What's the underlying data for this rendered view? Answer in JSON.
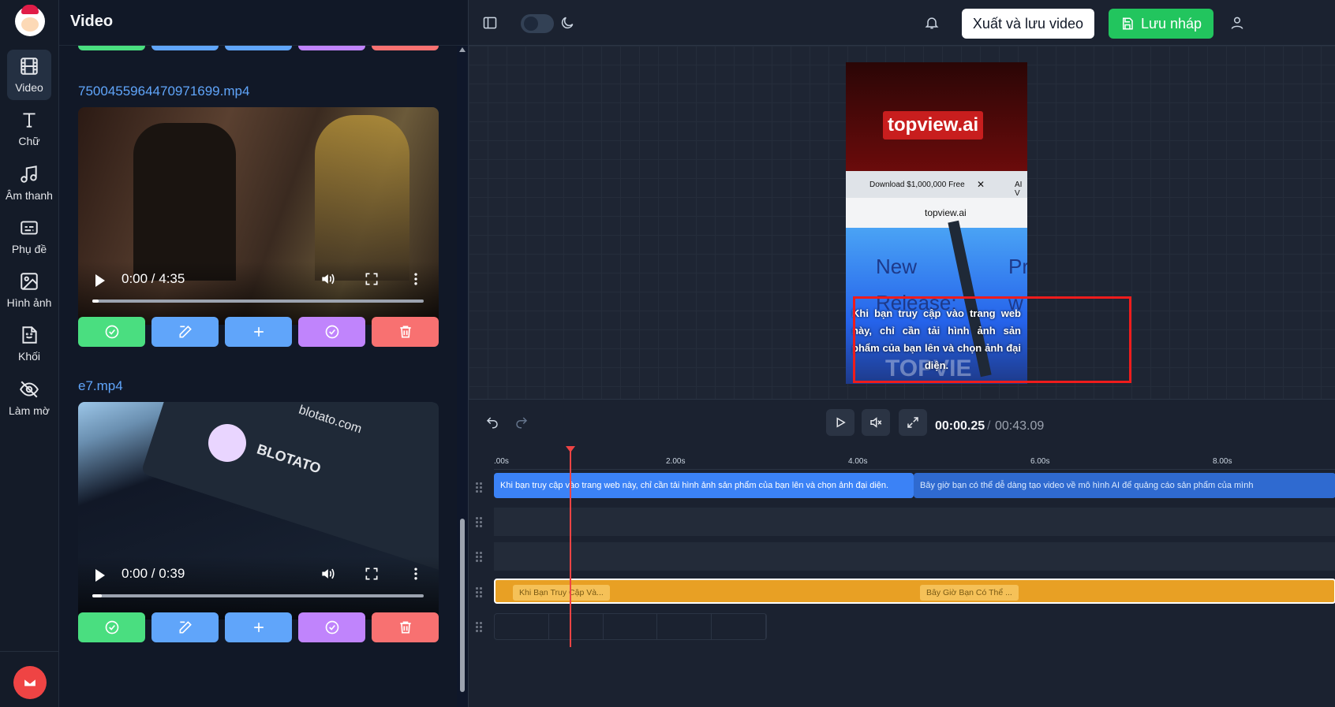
{
  "sidebar": {
    "items": [
      {
        "label": "Video",
        "icon": "film-icon"
      },
      {
        "label": "Chữ",
        "icon": "text-icon"
      },
      {
        "label": "Âm thanh",
        "icon": "music-icon"
      },
      {
        "label": "Phụ đề",
        "icon": "subtitles-icon"
      },
      {
        "label": "Hình ảnh",
        "icon": "image-icon"
      },
      {
        "label": "Khối",
        "icon": "sticker-icon"
      },
      {
        "label": "Làm mờ",
        "icon": "eye-off-icon"
      }
    ],
    "active_index": 0
  },
  "panel": {
    "title": "Video",
    "videos": [
      {
        "filename": "7500455964470971699.mp4",
        "time": "0:00 / 4:35"
      },
      {
        "filename": "e7.mp4",
        "time": "0:00 / 0:39",
        "brand": "BLOTATO",
        "site": "blotato.com"
      }
    ]
  },
  "topbar": {
    "export_label": "Xuất và lưu video",
    "save_label": "Lưu nháp"
  },
  "preview": {
    "brand": "topview.ai",
    "tab_title": "Download $1,000,000 Free",
    "tab_close": "✕",
    "tab2": "AI V",
    "url": "topview.ai",
    "headline": "New Release:",
    "side_text": "Pr w",
    "subtitle": "Khi bạn truy cập vào trang web này, chỉ cần tải hình ảnh sản phẩm của bạn lên và chọn ảnh đại diện.",
    "watermark": "TOPVIE"
  },
  "player": {
    "current_time": "00:00.25",
    "separator": "/",
    "total_time": "00:43.09"
  },
  "timeline": {
    "ticks": [
      ".00s",
      "2.00s",
      "4.00s",
      "6.00s",
      "8.00s"
    ],
    "subtitle_clips": [
      "Khi bạn truy cập vào trang web này, chỉ cần tải hình ảnh sản phẩm của bạn lên và chọn ảnh đại diện.",
      "Bây giờ bạn có thể dễ dàng tạo video về mô hình AI để quảng cáo sản phẩm của mình"
    ],
    "audio_clips": [
      "Khi Bạn Truy Cập Và...",
      "Bây Giờ Bạn Có Thể ..."
    ]
  },
  "colors": {
    "green": "#4ade80",
    "blue": "#60a5fa",
    "purple": "#c084fc",
    "red": "#f87171",
    "accent_save": "#22c55e",
    "playhead": "#ef4444"
  }
}
